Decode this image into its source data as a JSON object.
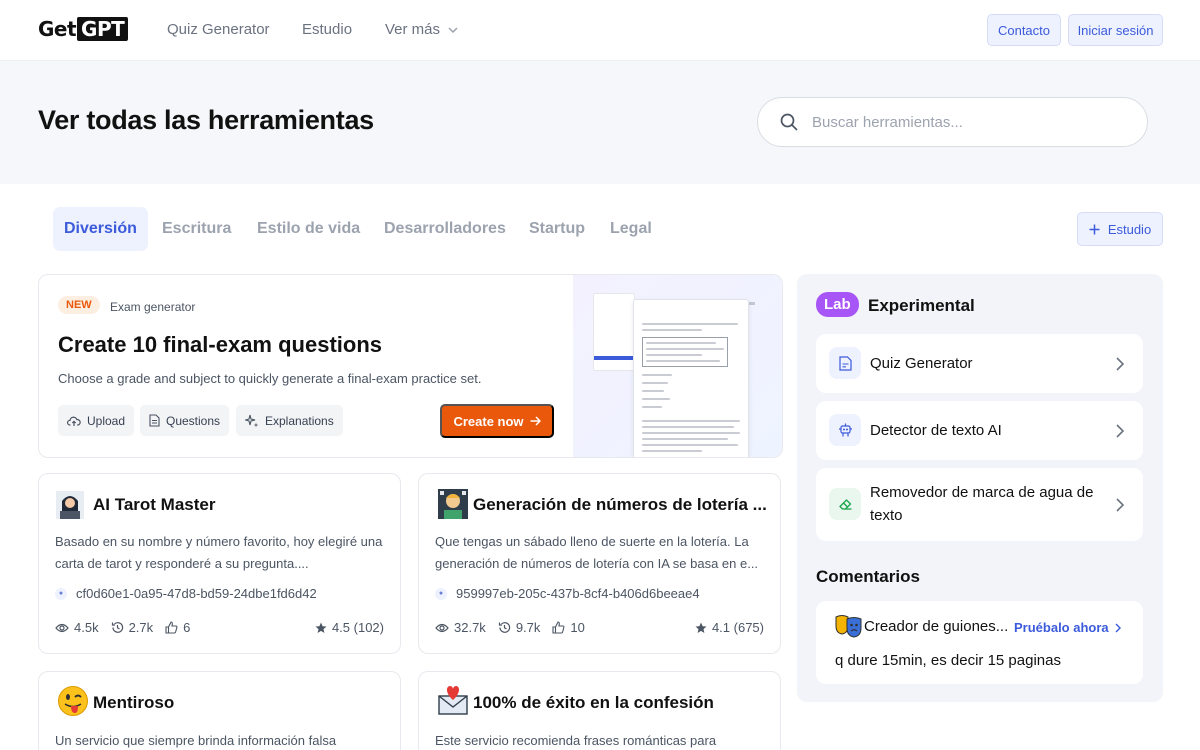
{
  "nav": {
    "logo_get": "Get",
    "logo_gpt": "GPT",
    "links": [
      "Quiz Generator",
      "Estudio",
      "Ver más"
    ],
    "contact": "Contacto",
    "login": "Iniciar sesión"
  },
  "hero": {
    "title": "Ver todas las herramientas",
    "search_placeholder": "Buscar herramientas..."
  },
  "tabs": [
    "Diversión",
    "Escritura",
    "Estilo de vida",
    "Desarrolladores",
    "Startup",
    "Legal"
  ],
  "active_tab": "Diversión",
  "studio_button": "Estudio",
  "feature": {
    "badge": "NEW",
    "tag": "Exam generator",
    "title": "Create 10 final-exam questions",
    "description": "Choose a grade and subject to quickly generate a final-exam practice set.",
    "chips": [
      "Upload",
      "Questions",
      "Explanations"
    ],
    "cta": "Create now"
  },
  "cards": [
    {
      "title": "AI Tarot Master",
      "description": "Basado en su nombre y número favorito, hoy elegiré una carta de tarot y responderé a su pregunta....",
      "id": "cf0d60e1-0a95-47d8-bd59-24dbe1fd6d42",
      "views": "4.5k",
      "uses": "2.7k",
      "likes": "6",
      "rating": "4.5 (102)",
      "avatar_icon": "tarot-reader-avatar"
    },
    {
      "title": "Generación de números de lotería ...",
      "description": "Que tengas un sábado lleno de suerte en la lotería. La generación de números de lotería con IA se basa en e...",
      "id": "959997eb-205c-437b-8cf4-b406d6beeae4",
      "views": "32.7k",
      "uses": "9.7k",
      "likes": "10",
      "rating": "4.1 (675)",
      "avatar_icon": "lottery-avatar"
    },
    {
      "title": "Mentiroso",
      "description": "Un servicio que siempre brinda información falsa",
      "avatar_icon": "tongue-out-emoji"
    },
    {
      "title": "100% de éxito en la confesión",
      "description": "Este servicio recomienda frases románticas para",
      "avatar_icon": "love-letter-emoji"
    }
  ],
  "lab": {
    "badge": "Lab",
    "title": "Experimental",
    "items": [
      "Quiz Generator",
      "Detector de texto AI",
      "Removedor de marca de agua de texto"
    ],
    "comments_title": "Comentarios",
    "comment": {
      "name": "Creador de guiones...",
      "try": "Pruébalo ahora",
      "text": "q dure 15min, es decir 15 paginas"
    }
  },
  "colors": {
    "accent": "#3b5bdb",
    "accent_bg": "#eef1fe",
    "cta_orange": "#ea580c",
    "lab_purple": "#a855f7"
  }
}
